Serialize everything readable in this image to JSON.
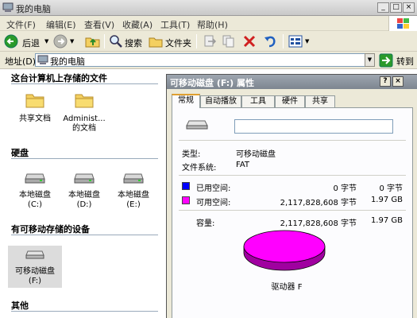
{
  "window": {
    "title": "我的电脑"
  },
  "menu": {
    "items": [
      "文件(F)",
      "编辑(E)",
      "查看(V)",
      "收藏(A)",
      "工具(T)",
      "帮助(H)"
    ]
  },
  "toolbar": {
    "back": "后退",
    "search": "搜索",
    "folders": "文件夹"
  },
  "address": {
    "label": "地址(D)",
    "value": "我的电脑",
    "go": "转到"
  },
  "sections": {
    "stored": "这台计算机上存储的文件",
    "harddisks": "硬盘",
    "removable": "有可移动存储的设备",
    "other": "其他"
  },
  "items": {
    "shared_docs": "共享文档",
    "admin_docs_1": "Administ...",
    "admin_docs_2": "的文档",
    "c_drive_1": "本地磁盘",
    "c_drive_2": "(C:)",
    "d_drive_1": "本地磁盘",
    "d_drive_2": "(D:)",
    "e_drive_1": "本地磁盘",
    "e_drive_2": "(E:)",
    "f_drive_1": "可移动磁盘",
    "f_drive_2": "(F:)"
  },
  "dialog": {
    "title": "可移动磁盘 (F:) 属性",
    "tabs": [
      "常规",
      "自动播放",
      "工具",
      "硬件",
      "共享"
    ],
    "type_label": "类型:",
    "type_value": "可移动磁盘",
    "fs_label": "文件系统:",
    "fs_value": "FAT",
    "used_label": "已用空间:",
    "used_bytes": "0 字节",
    "used_size": "0 字节",
    "free_label": "可用空间:",
    "free_bytes": "2,117,828,608 字节",
    "free_size": "1.97 GB",
    "cap_label": "容量:",
    "cap_bytes": "2,117,828,608 字节",
    "cap_size": "1.97 GB",
    "drive_label": "驱动器 F"
  },
  "colors": {
    "used": "#0000ff",
    "free": "#ff00ff"
  },
  "icons": [
    "folder-icon",
    "hard-drive-icon",
    "removable-drive-icon",
    "back-icon",
    "forward-icon",
    "up-icon",
    "search-icon",
    "folders-icon",
    "go-icon"
  ]
}
